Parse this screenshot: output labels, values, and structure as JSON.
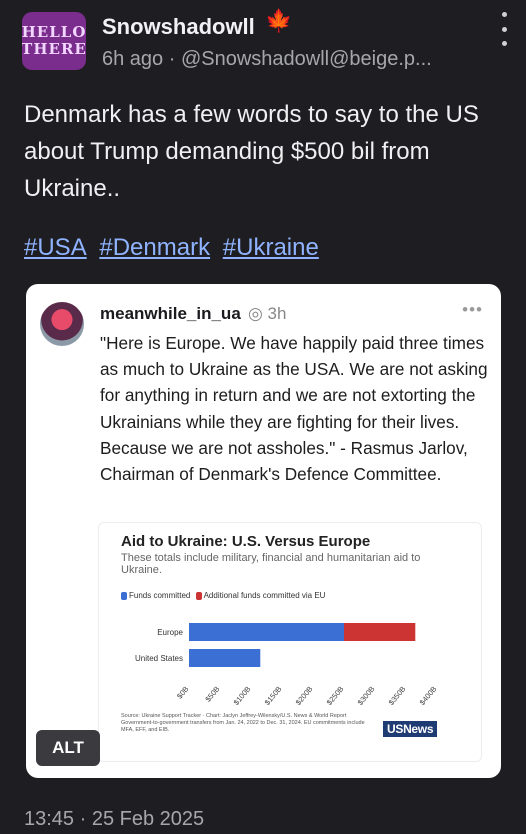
{
  "post": {
    "avatar_text_1": "HELLO",
    "avatar_text_2": "THERE",
    "username": "Snowshadowll",
    "flag_icon": "maple-leaf-icon",
    "meta": "6h ago · @Snowshadowll@beige.p...",
    "text": "Denmark has a few words to say to the US about Trump demanding $500 bil from Ukraine..",
    "hashtags": [
      "#USA",
      "#Denmark",
      "#Ukraine"
    ],
    "time": "13:45",
    "date": "25 Feb 2025"
  },
  "quote": {
    "username": "meanwhile_in_ua",
    "time": "◎ 3h",
    "more": "•••",
    "text": "\"Here is Europe. We have happily paid three times as much to Ukraine as the USA. We are not asking for anything in return and we are not extorting the Ukrainians while they are fighting for their lives. Because we are not assholes.\" - Rasmus Jarlov, Chairman of Denmark's Defence Committee.",
    "alt_label": "ALT"
  },
  "chart_data": {
    "type": "bar",
    "orientation": "horizontal",
    "stacked": true,
    "title": "Aid to Ukraine: U.S. Versus Europe",
    "subtitle": "These totals include military, financial and humanitarian aid to Ukraine.",
    "categories": [
      "Europe",
      "United States"
    ],
    "series": [
      {
        "name": "Funds committed",
        "color": "#3b6fd4",
        "values": [
          250,
          115
        ]
      },
      {
        "name": "Additional funds committed via EU",
        "color": "#cc3333",
        "values": [
          115,
          0
        ]
      }
    ],
    "x_ticks": [
      "$0B",
      "$50B",
      "$100B",
      "$150B",
      "$200B",
      "$250B",
      "$300B",
      "$350B",
      "$400B"
    ],
    "xlim": [
      0,
      400
    ],
    "legend_position": "top-left",
    "source": "Source: Ukraine Support Tracker · Chart: Jaclyn Jeffrey-Wilensky/U.S. News & World Report",
    "note": "Government-to-government transfers from Jan. 24, 2022 to Dec. 31, 2024. EU commitments include MFA, EFF, and EIB.",
    "brand": "USNews"
  },
  "colors": {
    "background": "#1e1e22",
    "hashtag": "#8fb3ff",
    "accent_blue": "#3b6fd4",
    "accent_red": "#cc3333"
  }
}
